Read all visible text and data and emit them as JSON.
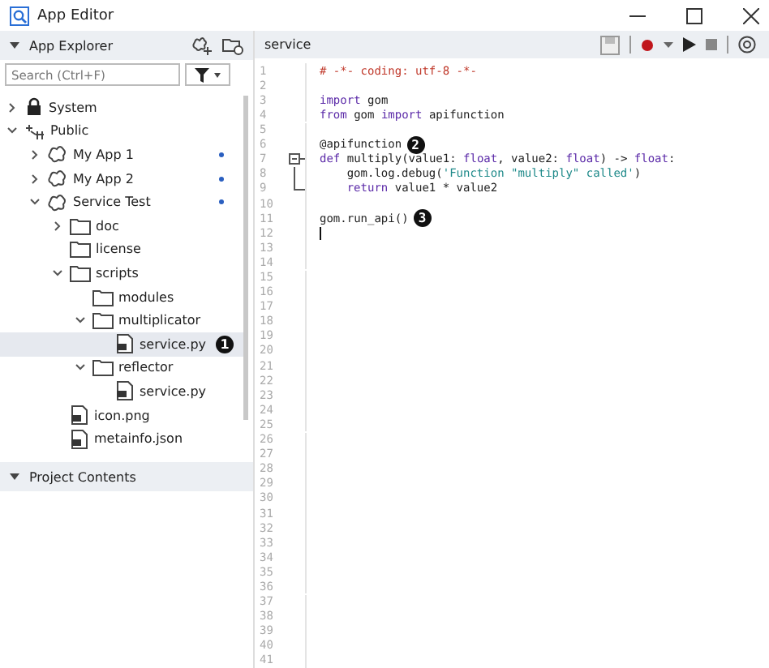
{
  "window": {
    "title": "App Editor"
  },
  "explorer": {
    "title": "App Explorer",
    "search": {
      "placeholder": "Search (Ctrl+F)"
    },
    "tree": [
      {
        "label": "System",
        "kind": "lock",
        "expanded": false,
        "selected": false
      },
      {
        "label": "Public",
        "kind": "network",
        "expanded": true,
        "selected": false,
        "children": [
          {
            "label": "My App 1",
            "kind": "app",
            "expanded": false,
            "selected": false,
            "dot": true
          },
          {
            "label": "My App 2",
            "kind": "app",
            "expanded": false,
            "selected": false,
            "dot": true
          },
          {
            "label": "Service Test",
            "kind": "app",
            "expanded": true,
            "selected": false,
            "dot": true,
            "children": [
              {
                "label": "doc",
                "kind": "folder",
                "expanded": false,
                "selected": false
              },
              {
                "label": "license",
                "kind": "folder",
                "selected": false
              },
              {
                "label": "scripts",
                "kind": "folder",
                "expanded": true,
                "selected": false,
                "children": [
                  {
                    "label": "modules",
                    "kind": "folder",
                    "selected": false
                  },
                  {
                    "label": "multiplicator",
                    "kind": "folder",
                    "expanded": true,
                    "selected": false,
                    "children": [
                      {
                        "label": "service.py",
                        "kind": "file",
                        "selected": true,
                        "callout": "1"
                      }
                    ]
                  },
                  {
                    "label": "reflector",
                    "kind": "folder",
                    "expanded": true,
                    "selected": false,
                    "children": [
                      {
                        "label": "service.py",
                        "kind": "file",
                        "selected": false
                      }
                    ]
                  }
                ]
              },
              {
                "label": "icon.png",
                "kind": "file",
                "selected": false
              },
              {
                "label": "metainfo.json",
                "kind": "file",
                "selected": false
              }
            ]
          }
        ]
      }
    ],
    "project_contents": {
      "title": "Project Contents"
    }
  },
  "editor": {
    "tab": "service",
    "lines": [
      {
        "number": "1",
        "kind": "code",
        "tokens": [
          {
            "kind": "comment",
            "text": "# -*- coding: utf-8 -*-"
          }
        ]
      },
      {
        "number": "2",
        "kind": "code"
      },
      {
        "number": "3",
        "kind": "code",
        "tokens": [
          {
            "kind": "keyword",
            "text": "import"
          },
          {
            "kind": "plain",
            "text": " gom"
          }
        ]
      },
      {
        "number": "4",
        "kind": "code",
        "tokens": [
          {
            "kind": "keyword",
            "text": "from"
          },
          {
            "kind": "plain",
            "text": " gom "
          },
          {
            "kind": "keyword",
            "text": "import"
          },
          {
            "kind": "plain",
            "text": " apifunction"
          }
        ]
      },
      {
        "number": "5",
        "kind": "code"
      },
      {
        "number": "6",
        "kind": "code",
        "tokens": [
          {
            "kind": "plain",
            "text": "@apifunction"
          }
        ],
        "callout": "2"
      },
      {
        "number": "7",
        "kind": "foldstart",
        "tokens": [
          {
            "kind": "keyword",
            "text": "def"
          },
          {
            "kind": "plain",
            "text": " multiply(value1: "
          },
          {
            "kind": "keyword",
            "text": "float"
          },
          {
            "kind": "plain",
            "text": ", value2: "
          },
          {
            "kind": "keyword",
            "text": "float"
          },
          {
            "kind": "plain",
            "text": ") -> "
          },
          {
            "kind": "keyword",
            "text": "float"
          },
          {
            "kind": "plain",
            "text": ":"
          }
        ]
      },
      {
        "number": "8",
        "kind": "foldbody",
        "indented": true,
        "tokens": [
          {
            "kind": "plain",
            "text": "gom.log.debug("
          },
          {
            "kind": "string",
            "text": "'Function \"multiply\" called'"
          },
          {
            "kind": "plain",
            "text": ")"
          }
        ]
      },
      {
        "number": "9",
        "kind": "foldend",
        "indented": true,
        "tokens": [
          {
            "kind": "keyword",
            "text": "return"
          },
          {
            "kind": "plain",
            "text": " value1 * value2"
          }
        ]
      },
      {
        "number": "10",
        "kind": "code"
      },
      {
        "number": "11",
        "kind": "code",
        "tokens": [
          {
            "kind": "plain",
            "text": "gom.run_api()"
          }
        ],
        "callout": "3"
      },
      {
        "number": "12",
        "kind": "code",
        "cursor": true
      },
      {
        "number": "13",
        "kind": "code"
      },
      {
        "number": "14",
        "kind": "code"
      },
      {
        "number": "15",
        "kind": "code"
      },
      {
        "number": "16",
        "kind": "code"
      },
      {
        "number": "17",
        "kind": "code"
      },
      {
        "number": "18",
        "kind": "code"
      },
      {
        "number": "19",
        "kind": "code"
      },
      {
        "number": "20",
        "kind": "code"
      },
      {
        "number": "21",
        "kind": "code"
      },
      {
        "number": "22",
        "kind": "code"
      },
      {
        "number": "23",
        "kind": "code"
      },
      {
        "number": "24",
        "kind": "code"
      },
      {
        "number": "25",
        "kind": "code"
      },
      {
        "number": "26",
        "kind": "code"
      },
      {
        "number": "27",
        "kind": "code"
      },
      {
        "number": "28",
        "kind": "code"
      },
      {
        "number": "29",
        "kind": "code"
      },
      {
        "number": "30",
        "kind": "code"
      },
      {
        "number": "31",
        "kind": "code"
      },
      {
        "number": "32",
        "kind": "code"
      },
      {
        "number": "33",
        "kind": "code"
      },
      {
        "number": "34",
        "kind": "code"
      },
      {
        "number": "35",
        "kind": "code"
      },
      {
        "number": "36",
        "kind": "code"
      },
      {
        "number": "37",
        "kind": "code"
      },
      {
        "number": "38",
        "kind": "code"
      },
      {
        "number": "39",
        "kind": "code"
      },
      {
        "number": "40",
        "kind": "code"
      },
      {
        "number": "41",
        "kind": "code"
      }
    ]
  }
}
